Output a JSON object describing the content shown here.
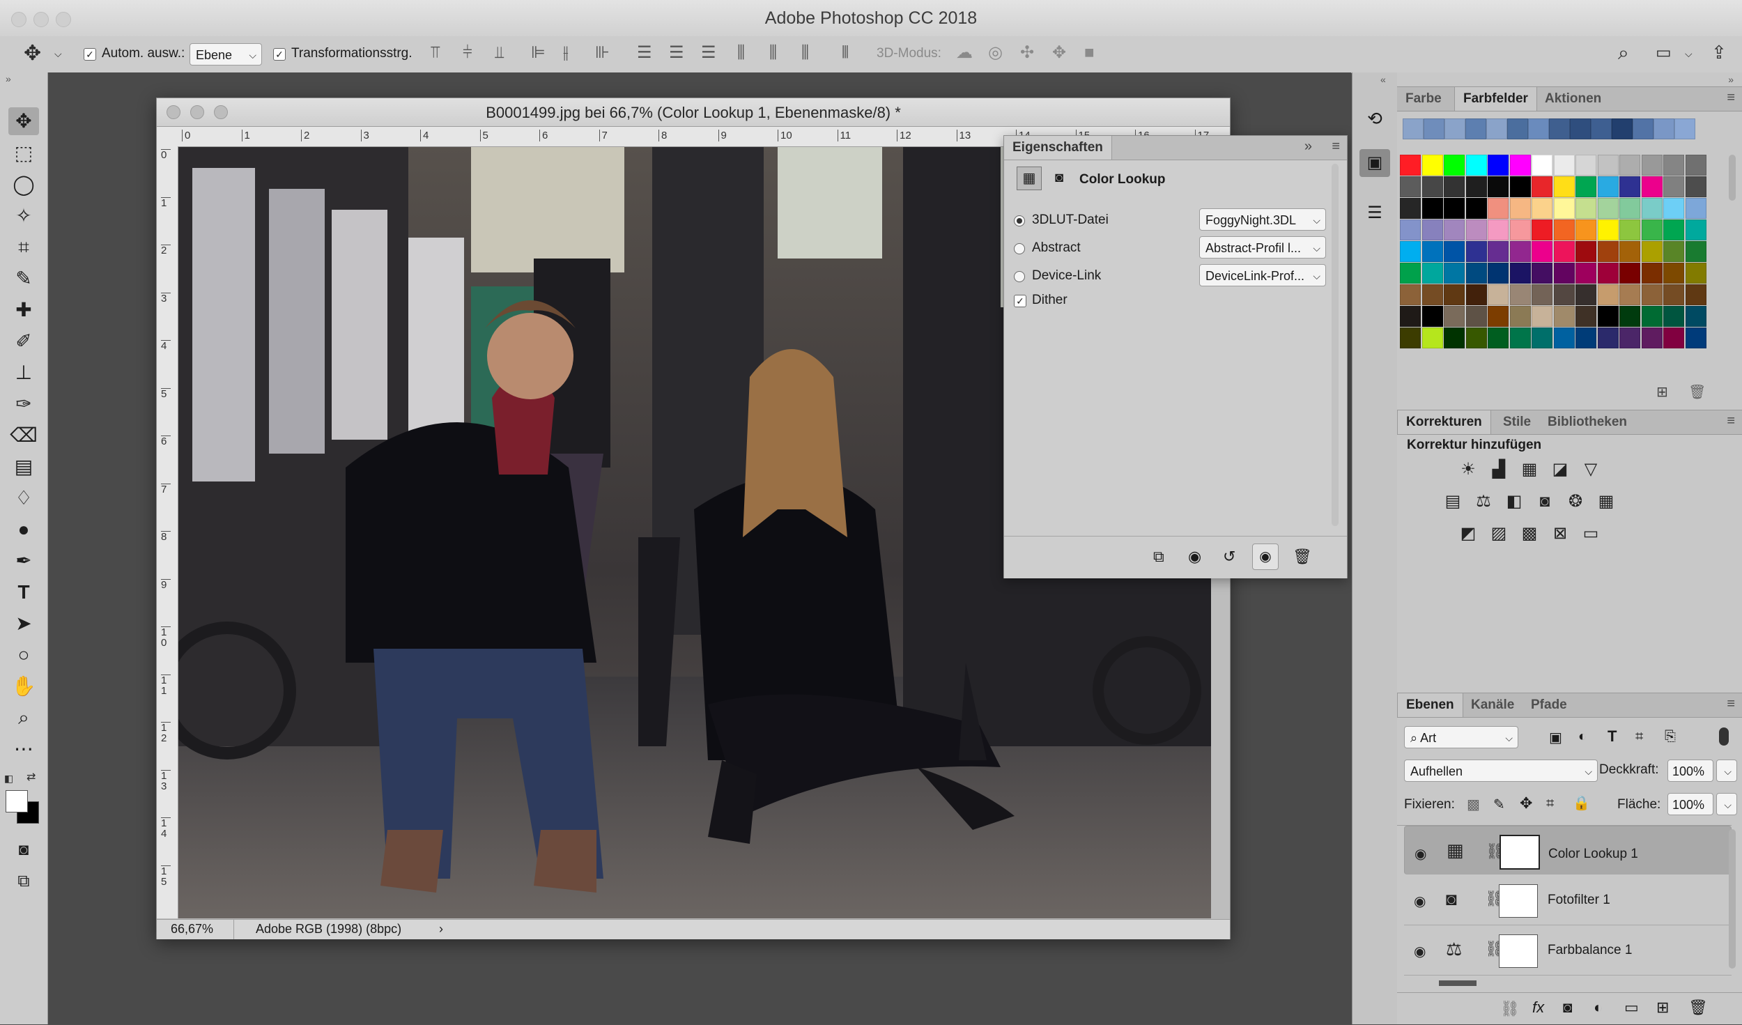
{
  "window": {
    "title": "Adobe Photoshop CC 2018"
  },
  "options_bar": {
    "auto_select_label": "Autom. ausw.:",
    "auto_select_value": "Ebene",
    "transform_label": "Transformationsstrg.",
    "mode_3d_label": "3D-Modus:"
  },
  "document": {
    "title": "B0001499.jpg bei 66,7% (Color Lookup 1, Ebenenmaske/8) *",
    "ruler_h": [
      "0",
      "1",
      "2",
      "3",
      "4",
      "5",
      "6",
      "7",
      "8",
      "9",
      "10",
      "11",
      "12",
      "13",
      "14",
      "15",
      "16",
      "17"
    ],
    "ruler_v": [
      "0",
      "1",
      "2",
      "3",
      "4",
      "5",
      "6",
      "7",
      "8",
      "9",
      "10",
      "11",
      "12",
      "13",
      "14",
      "15"
    ],
    "zoom": "66,67%",
    "color_profile": "Adobe RGB (1998) (8bpc)"
  },
  "properties": {
    "tab": "Eigenschaften",
    "title": "Color Lookup",
    "rows": [
      {
        "label": "3DLUT-Datei",
        "value": "FoggyNight.3DL",
        "selected": true
      },
      {
        "label": "Abstract",
        "value": "Abstract-Profil l...",
        "selected": false
      },
      {
        "label": "Device-Link",
        "value": "DeviceLink-Prof...",
        "selected": false
      }
    ],
    "dither_label": "Dither"
  },
  "swatches_panel": {
    "tabs": [
      "Farbe",
      "Farbfelder",
      "Aktionen"
    ],
    "active": "Farbfelder",
    "recent": [
      "#8aa3c9",
      "#6f8dbb",
      "#8aa3c9",
      "#5d7fb0",
      "#8aa3c9",
      "#4b6e9e",
      "#6a8bbd",
      "#3f5f8f",
      "#2f4e7e",
      "#3e5f91",
      "#223f6e",
      "#5273a6",
      "#7a97c6",
      "#8aa7d4"
    ],
    "grid": [
      [
        "#ff1d25",
        "#ffff00",
        "#00ff00",
        "#00ffff",
        "#0000ff",
        "#ff00ff",
        "#ffffff",
        "#ebebeb",
        "#d6d6d6",
        "#c2c2c2",
        "#adadad",
        "#999999",
        "#858585",
        "#707070"
      ],
      [
        "#5c5c5c",
        "#474747",
        "#333333",
        "#1f1f1f",
        "#0a0a0a",
        "#000000",
        "#e8262a",
        "#ffde17",
        "#00a651",
        "#29aae2",
        "#2e3192",
        "#ec008c",
        "#808080",
        "#4d4d4d"
      ],
      [
        "#262626",
        "#000000",
        "#000000",
        "#000000",
        "#f0907f",
        "#f6b783",
        "#fbd28b",
        "#fff799",
        "#c5df8f",
        "#a3d39c",
        "#82ca9c",
        "#7accc8",
        "#6dcff6",
        "#7da7d9"
      ],
      [
        "#8393ca",
        "#8781bd",
        "#a186be",
        "#bc8cbf",
        "#f49ac2",
        "#f6989d",
        "#ed1c24",
        "#f26522",
        "#f7941d",
        "#fff200",
        "#8dc63f",
        "#39b54a",
        "#00a651",
        "#00a99d"
      ],
      [
        "#00aeef",
        "#0072bc",
        "#0054a6",
        "#2e3192",
        "#662d91",
        "#92278f",
        "#ec008c",
        "#ed145b",
        "#9e0b0f",
        "#a0410d",
        "#a36209",
        "#aba000",
        "#598527",
        "#197b30"
      ],
      [
        "#00a14b",
        "#00a79d",
        "#0076a3",
        "#004a80",
        "#003471",
        "#1b1464",
        "#440e62",
        "#630460",
        "#9e005d",
        "#9e0039",
        "#790000",
        "#7b2e00",
        "#7d4900",
        "#827b00"
      ],
      [
        "#8c6239",
        "#754c24",
        "#603913",
        "#42210b",
        "#c7b299",
        "#998675",
        "#736357",
        "#534741",
        "#362f2d",
        "#c69c6d",
        "#a67c52",
        "#8c6239",
        "#754c24",
        "#603913"
      ],
      [
        "#1f1a17",
        "#000000",
        "#7a6b5b",
        "#5e5246",
        "#7c3d00",
        "#8b7a55",
        "#c7b299",
        "#a08a6a",
        "#3f3126",
        "#000000",
        "#003b0e",
        "#006b33",
        "#00553f",
        "#004a62"
      ],
      [
        "#3c3c00",
        "#b5e61d",
        "#003300",
        "#375800",
        "#005e20",
        "#00754a",
        "#006f6a",
        "#0061a0",
        "#003c78",
        "#2b2a6b",
        "#4b2668",
        "#5f1c60",
        "#810040",
        "#003b7a"
      ]
    ]
  },
  "adjustments_panel": {
    "tabs": [
      "Korrekturen",
      "Stile",
      "Bibliotheken"
    ],
    "active": "Korrekturen",
    "heading": "Korrektur hinzufügen"
  },
  "layers_panel": {
    "tabs": [
      "Ebenen",
      "Kanäle",
      "Pfade"
    ],
    "active": "Ebenen",
    "filter_value": "Art",
    "blend_mode": "Aufhellen",
    "opacity_label": "Deckkraft:",
    "opacity_value": "100%",
    "lock_label": "Fixieren:",
    "fill_label": "Fläche:",
    "fill_value": "100%",
    "layers": [
      {
        "name": "Color Lookup 1",
        "icon": "grid-icon",
        "selected": true
      },
      {
        "name": "Fotofilter 1",
        "icon": "camera-icon",
        "selected": false
      },
      {
        "name": "Farbbalance 1",
        "icon": "balance-icon",
        "selected": false
      }
    ]
  }
}
